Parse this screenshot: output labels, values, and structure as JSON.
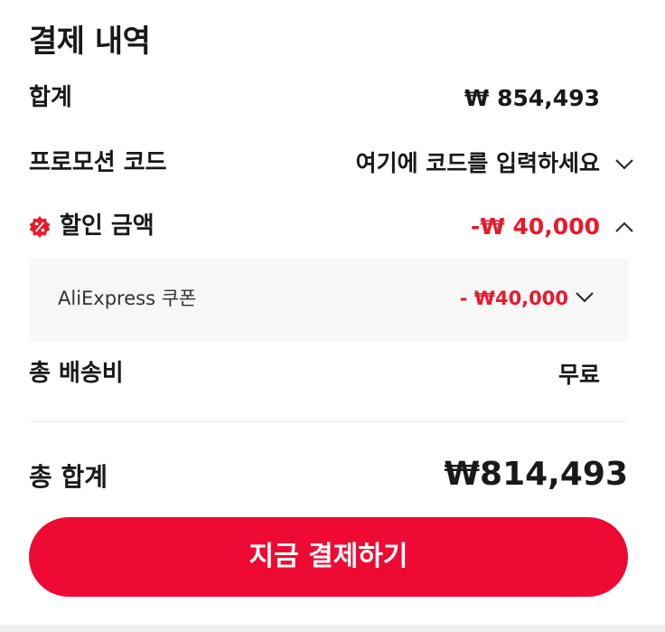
{
  "summary": {
    "title": "결제 내역",
    "subtotal_label": "합계",
    "subtotal_value": "₩ 854,493",
    "promo_label": "프로모션 코드",
    "promo_placeholder": "여기에 코드를 입력하세요",
    "discount_label": "할인 금액",
    "discount_value": "-₩ 40,000",
    "coupon": {
      "name": "AliExpress 쿠폰",
      "amount": "- ₩40,000"
    },
    "shipping_label": "총 배송비",
    "shipping_value": "무료",
    "total_label": "총 합계",
    "total_value": "₩814,493",
    "pay_button": "지금 결제하기"
  },
  "colors": {
    "accent": "#ee0a33",
    "discount_text": "#e8192c",
    "coupon_bg": "#f7f7f7"
  },
  "icons": {
    "promo_toggle": "chevron-down-icon",
    "discount_toggle": "chevron-up-icon",
    "coupon_toggle": "chevron-down-icon",
    "discount_badge": "percent-badge-icon"
  }
}
